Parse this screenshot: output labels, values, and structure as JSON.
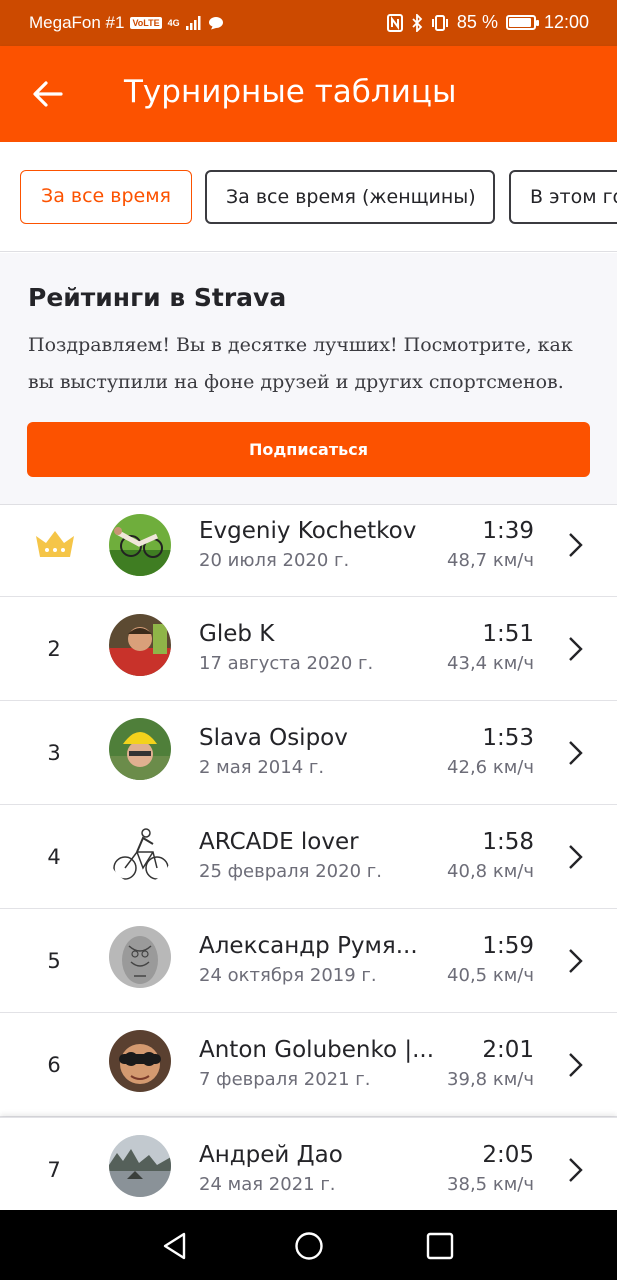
{
  "status_bar": {
    "carrier": "MegaFon #1",
    "volte": "VoLTE",
    "network": "4G",
    "battery_percent": "85 %",
    "battery_level": 0.85,
    "time": "12:00"
  },
  "header": {
    "title": "Турнирные таблицы",
    "back_icon": "arrow-left-icon"
  },
  "filters": [
    {
      "label": "За все время",
      "active": true
    },
    {
      "label": "За все время (женщины)",
      "active": false
    },
    {
      "label": "В этом году",
      "active": false
    }
  ],
  "promo": {
    "title": "Рейтинги в Strava",
    "text": "Поздравляем! Вы в десятке лучших! Посмотрите, как вы выступили на фоне друзей и других спортсменов.",
    "button_label": "Подписаться"
  },
  "leaderboard": [
    {
      "rank": "1",
      "crown": true,
      "name": "Evgeniy Kochetkov",
      "date": "20 июля 2020 г.",
      "time": "1:39",
      "speed": "48,7 км/ч"
    },
    {
      "rank": "2",
      "name": "Gleb K",
      "date": "17 августа 2020 г.",
      "time": "1:51",
      "speed": "43,4 км/ч"
    },
    {
      "rank": "3",
      "name": "Slava Osipov",
      "date": "2 мая 2014 г.",
      "time": "1:53",
      "speed": "42,6 км/ч"
    },
    {
      "rank": "4",
      "name": "ARCADE lover",
      "date": "25 февраля 2020 г.",
      "time": "1:58",
      "speed": "40,8 км/ч"
    },
    {
      "rank": "5",
      "name": "Александр Румя...",
      "date": "24 октября 2019 г.",
      "time": "1:59",
      "speed": "40,5 км/ч"
    },
    {
      "rank": "6",
      "name": "Anton Golubenko |...",
      "date": "7 февраля 2021 г.",
      "time": "2:01",
      "speed": "39,8 км/ч"
    },
    {
      "rank": "7",
      "name": "Андрей Дао",
      "date": "24 мая 2021 г.",
      "time": "2:05",
      "speed": "38,5 км/ч"
    }
  ],
  "colors": {
    "brand": "#fc5200",
    "status_bar": "#cc4a00",
    "crown": "#f5c548"
  },
  "nav_bar": {
    "icons": [
      "back-triangle-icon",
      "home-circle-icon",
      "recents-square-icon"
    ]
  }
}
